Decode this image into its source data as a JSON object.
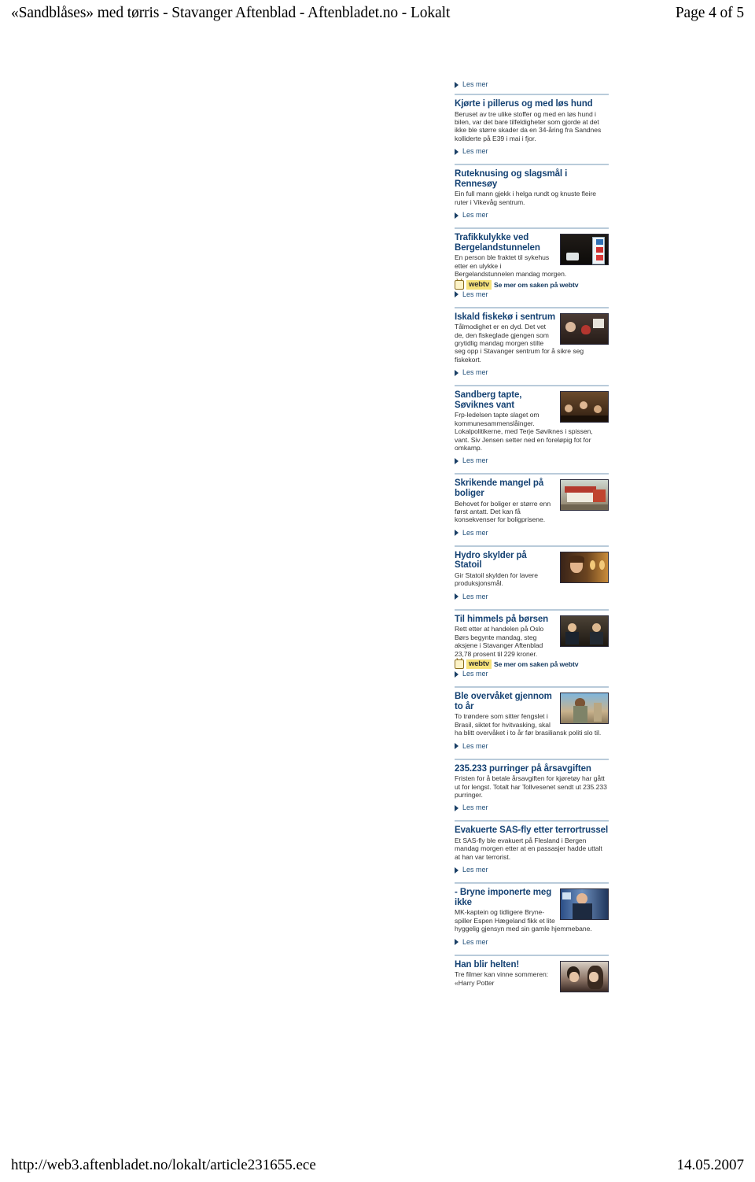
{
  "print_header": {
    "title": "«Sandblåses» med tørris - Stavanger Aftenblad - Aftenbladet.no - Lokalt",
    "page_number": "Page 4 of 5"
  },
  "print_footer": {
    "url": "http://web3.aftenbladet.no/lokalt/article231655.ece",
    "date": "14.05.2007"
  },
  "labels": {
    "read_more": "Les mer",
    "webtv_badge": "webtv",
    "webtv_text": "Se mer om saken på webtv"
  },
  "colors": {
    "heading": "#154273",
    "body_text": "#333333",
    "link": "#1f4e79",
    "divider": "#b9cbda",
    "webtv_badge_bg": "#f6e27a"
  },
  "top_read_more": "Les mer",
  "teasers": [
    {
      "heading": "Kjørte i pillerus og med løs hund",
      "body": "Beruset av tre ulike stoffer og med en løs hund i bilen, var det bare tilfeldigheter som gjorde at det ikke ble større skader da en 34-åring fra Sandnes kolliderte på E39 i mai i fjor.",
      "read_more": "Les mer",
      "has_thumb": false,
      "has_webtv": false
    },
    {
      "heading": "Ruteknusing og slagsmål i Rennesøy",
      "body": "Ein full mann gjekk i helga rundt og knuste fleire ruter i Vikevåg sentrum.",
      "read_more": "Les mer",
      "has_thumb": false,
      "has_webtv": false
    },
    {
      "heading": "Trafikkulykke ved Bergelandstunnelen",
      "body": "En person ble fraktet til sykehus etter en ulykke i Bergelandstunnelen mandag morgen.",
      "read_more": "Les mer",
      "has_thumb": true,
      "thumb_name": "thumbnail-bergelandstunnelen",
      "has_webtv": true
    },
    {
      "heading": "Iskald fiskekø i sentrum",
      "body": "Tålmodighet er en dyd. Det vet de, den fiskeglade gjengen som grytidlig mandag morgen stilte seg opp i Stavanger sentrum for å sikre seg fiskekort.",
      "read_more": "Les mer",
      "has_thumb": true,
      "thumb_name": "thumbnail-fiskeko",
      "has_webtv": false
    },
    {
      "heading": "Sandberg tapte, Søviknes vant",
      "body": "Frp-ledelsen tapte slaget om kommunesammenslåinger. Lokalpolitikerne, med Terje Søviknes i spissen, vant. Siv Jensen setter ned en foreløpig fot for omkamp.",
      "read_more": "Les mer",
      "has_thumb": true,
      "thumb_name": "thumbnail-sandberg",
      "has_webtv": false
    },
    {
      "heading": "Skrikende mangel på boliger",
      "body": "Behovet for boliger er større enn først antatt. Det kan få konsekvenser for boligprisene.",
      "read_more": "Les mer",
      "has_thumb": true,
      "thumb_name": "thumbnail-boliger",
      "has_webtv": false
    },
    {
      "heading": "Hydro skylder på Statoil",
      "body": "Gir Statoil skylden for lavere produksjonsmål.",
      "read_more": "Les mer",
      "has_thumb": true,
      "thumb_name": "thumbnail-hydro",
      "has_webtv": false
    },
    {
      "heading": "Til himmels på børsen",
      "body": "Rett etter at handelen på Oslo Børs begynte mandag, steg aksjene i Stavanger Aftenblad 23,78 prosent til 229 kroner.",
      "read_more": "Les mer",
      "has_thumb": true,
      "thumb_name": "thumbnail-borsen",
      "has_webtv": true
    },
    {
      "heading": "Ble overvåket gjennom to år",
      "body": "To trøndere som sitter fengslet i Brasil, siktet for hvitvasking, skal ha blitt overvåket i to år før brasiliansk politi slo til.",
      "read_more": "Les mer",
      "has_thumb": true,
      "thumb_name": "thumbnail-overvaket",
      "has_webtv": false
    },
    {
      "heading": "235.233 purringer på årsavgiften",
      "body": "Fristen for å betale årsavgiften for kjøretøy har gått ut for lengst. Totalt har Tollvesenet sendt ut 235.233 purringer.",
      "read_more": "Les mer",
      "has_thumb": false,
      "has_webtv": false
    },
    {
      "heading": "Evakuerte SAS-fly etter terrortrussel",
      "body": "Et SAS-fly ble evakuert på Flesland i Bergen mandag morgen etter at en passasjer hadde uttalt at han var terrorist.",
      "read_more": "Les mer",
      "has_thumb": false,
      "has_webtv": false
    },
    {
      "heading": "- Bryne imponerte meg ikke",
      "body": "MK-kaptein og tidligere Bryne-spiller Espen Hægeland fikk et lite hyggelig gjensyn med sin gamle hjemmebane.",
      "read_more": "Les mer",
      "has_thumb": true,
      "thumb_name": "thumbnail-bryne",
      "has_webtv": false
    },
    {
      "heading": "Han blir helten!",
      "body": "Tre filmer kan vinne sommeren: «Harry Potter",
      "read_more": "",
      "has_thumb": true,
      "thumb_name": "thumbnail-helten",
      "has_webtv": false
    }
  ]
}
